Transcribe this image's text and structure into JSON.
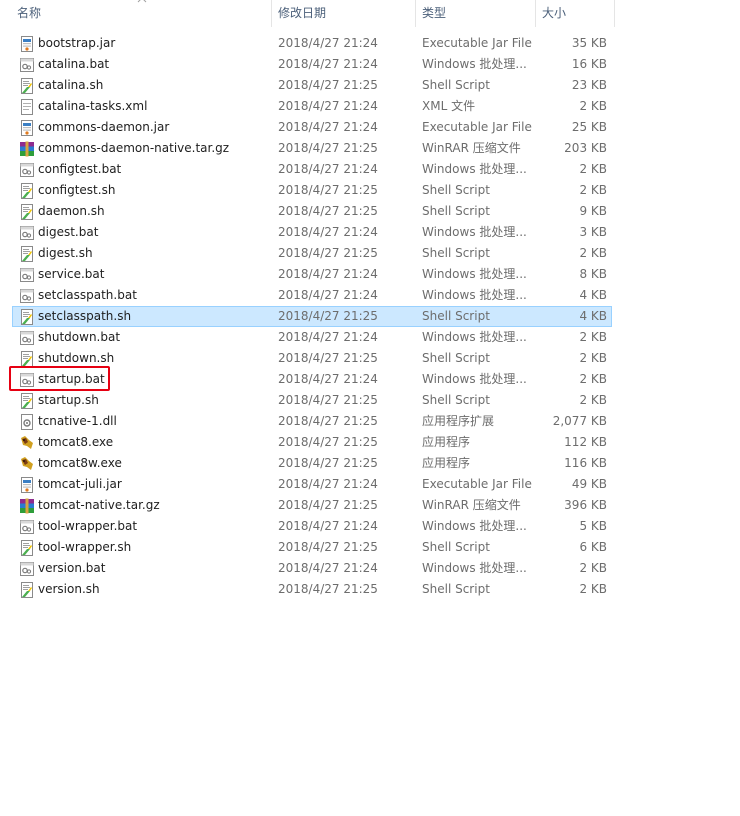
{
  "columns": {
    "name": "名称",
    "date": "修改日期",
    "type": "类型",
    "size": "大小"
  },
  "colors": {
    "selection_bg": "#cce8ff",
    "selection_border": "#99d1ff",
    "highlight": "#e60012",
    "header_text": "#4c607a"
  },
  "files": [
    {
      "name": "bootstrap.jar",
      "date": "2018/4/27 21:24",
      "type": "Executable Jar File",
      "size": "35 KB",
      "icon": "jar-icon"
    },
    {
      "name": "catalina.bat",
      "date": "2018/4/27 21:24",
      "type": "Windows 批处理...",
      "size": "16 KB",
      "icon": "bat-icon"
    },
    {
      "name": "catalina.sh",
      "date": "2018/4/27 21:25",
      "type": "Shell Script",
      "size": "23 KB",
      "icon": "sh-icon"
    },
    {
      "name": "catalina-tasks.xml",
      "date": "2018/4/27 21:24",
      "type": "XML 文件",
      "size": "2 KB",
      "icon": "xml-icon"
    },
    {
      "name": "commons-daemon.jar",
      "date": "2018/4/27 21:24",
      "type": "Executable Jar File",
      "size": "25 KB",
      "icon": "jar-icon"
    },
    {
      "name": "commons-daemon-native.tar.gz",
      "date": "2018/4/27 21:25",
      "type": "WinRAR 压缩文件",
      "size": "203 KB",
      "icon": "winrar-icon"
    },
    {
      "name": "configtest.bat",
      "date": "2018/4/27 21:24",
      "type": "Windows 批处理...",
      "size": "2 KB",
      "icon": "bat-icon"
    },
    {
      "name": "configtest.sh",
      "date": "2018/4/27 21:25",
      "type": "Shell Script",
      "size": "2 KB",
      "icon": "sh-icon"
    },
    {
      "name": "daemon.sh",
      "date": "2018/4/27 21:25",
      "type": "Shell Script",
      "size": "9 KB",
      "icon": "sh-icon"
    },
    {
      "name": "digest.bat",
      "date": "2018/4/27 21:24",
      "type": "Windows 批处理...",
      "size": "3 KB",
      "icon": "bat-icon"
    },
    {
      "name": "digest.sh",
      "date": "2018/4/27 21:25",
      "type": "Shell Script",
      "size": "2 KB",
      "icon": "sh-icon"
    },
    {
      "name": "service.bat",
      "date": "2018/4/27 21:24",
      "type": "Windows 批处理...",
      "size": "8 KB",
      "icon": "bat-icon"
    },
    {
      "name": "setclasspath.bat",
      "date": "2018/4/27 21:24",
      "type": "Windows 批处理...",
      "size": "4 KB",
      "icon": "bat-icon"
    },
    {
      "name": "setclasspath.sh",
      "date": "2018/4/27 21:25",
      "type": "Shell Script",
      "size": "4 KB",
      "icon": "sh-icon",
      "selected": true
    },
    {
      "name": "shutdown.bat",
      "date": "2018/4/27 21:24",
      "type": "Windows 批处理...",
      "size": "2 KB",
      "icon": "bat-icon"
    },
    {
      "name": "shutdown.sh",
      "date": "2018/4/27 21:25",
      "type": "Shell Script",
      "size": "2 KB",
      "icon": "sh-icon"
    },
    {
      "name": "startup.bat",
      "date": "2018/4/27 21:24",
      "type": "Windows 批处理...",
      "size": "2 KB",
      "icon": "bat-icon",
      "highlighted": true
    },
    {
      "name": "startup.sh",
      "date": "2018/4/27 21:25",
      "type": "Shell Script",
      "size": "2 KB",
      "icon": "sh-icon"
    },
    {
      "name": "tcnative-1.dll",
      "date": "2018/4/27 21:25",
      "type": "应用程序扩展",
      "size": "2,077 KB",
      "icon": "dll-icon"
    },
    {
      "name": "tomcat8.exe",
      "date": "2018/4/27 21:25",
      "type": "应用程序",
      "size": "112 KB",
      "icon": "tomcat-exe-icon"
    },
    {
      "name": "tomcat8w.exe",
      "date": "2018/4/27 21:25",
      "type": "应用程序",
      "size": "116 KB",
      "icon": "tomcat-exe-icon"
    },
    {
      "name": "tomcat-juli.jar",
      "date": "2018/4/27 21:24",
      "type": "Executable Jar File",
      "size": "49 KB",
      "icon": "jar-icon"
    },
    {
      "name": "tomcat-native.tar.gz",
      "date": "2018/4/27 21:25",
      "type": "WinRAR 压缩文件",
      "size": "396 KB",
      "icon": "winrar-icon"
    },
    {
      "name": "tool-wrapper.bat",
      "date": "2018/4/27 21:24",
      "type": "Windows 批处理...",
      "size": "5 KB",
      "icon": "bat-icon"
    },
    {
      "name": "tool-wrapper.sh",
      "date": "2018/4/27 21:25",
      "type": "Shell Script",
      "size": "6 KB",
      "icon": "sh-icon"
    },
    {
      "name": "version.bat",
      "date": "2018/4/27 21:24",
      "type": "Windows 批处理...",
      "size": "2 KB",
      "icon": "bat-icon"
    },
    {
      "name": "version.sh",
      "date": "2018/4/27 21:25",
      "type": "Shell Script",
      "size": "2 KB",
      "icon": "sh-icon"
    }
  ]
}
